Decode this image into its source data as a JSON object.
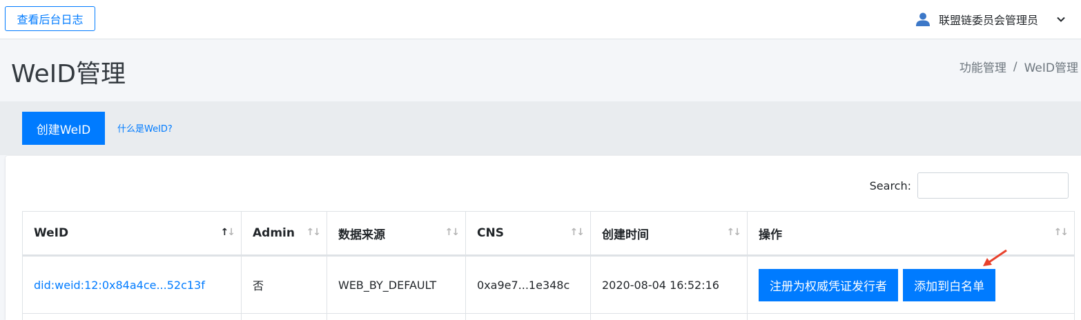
{
  "navbar": {
    "log_button": "查看后台日志",
    "user_name": "联盟链委员会管理员"
  },
  "header": {
    "title": "WeID管理",
    "breadcrumb": [
      "功能管理",
      "WeID管理"
    ],
    "separator": "/"
  },
  "actions": {
    "create_button": "创建WeID",
    "what_link": "什么是WeID?"
  },
  "table": {
    "search_label": "Search:",
    "search_value": "",
    "columns": [
      "WeID",
      "Admin",
      "数据来源",
      "CNS",
      "创建时间",
      "操作"
    ],
    "sort_active_column": "WeID",
    "rows": [
      {
        "weid": "did:weid:12:0x84a4ce...52c13f",
        "admin": "否",
        "source": "WEB_BY_DEFAULT",
        "cns": "0xa9e7...1e348c",
        "created": "2020-08-04 16:52:16",
        "buttons": [
          "注册为权威凭证发行者",
          "添加到白名单"
        ]
      }
    ]
  },
  "colors": {
    "primary": "#007bff",
    "annotation_arrow": "#e8412c"
  },
  "icons": [
    "user-icon",
    "chevron-down-icon",
    "sort-icon",
    "annotation-arrow-icon"
  ]
}
